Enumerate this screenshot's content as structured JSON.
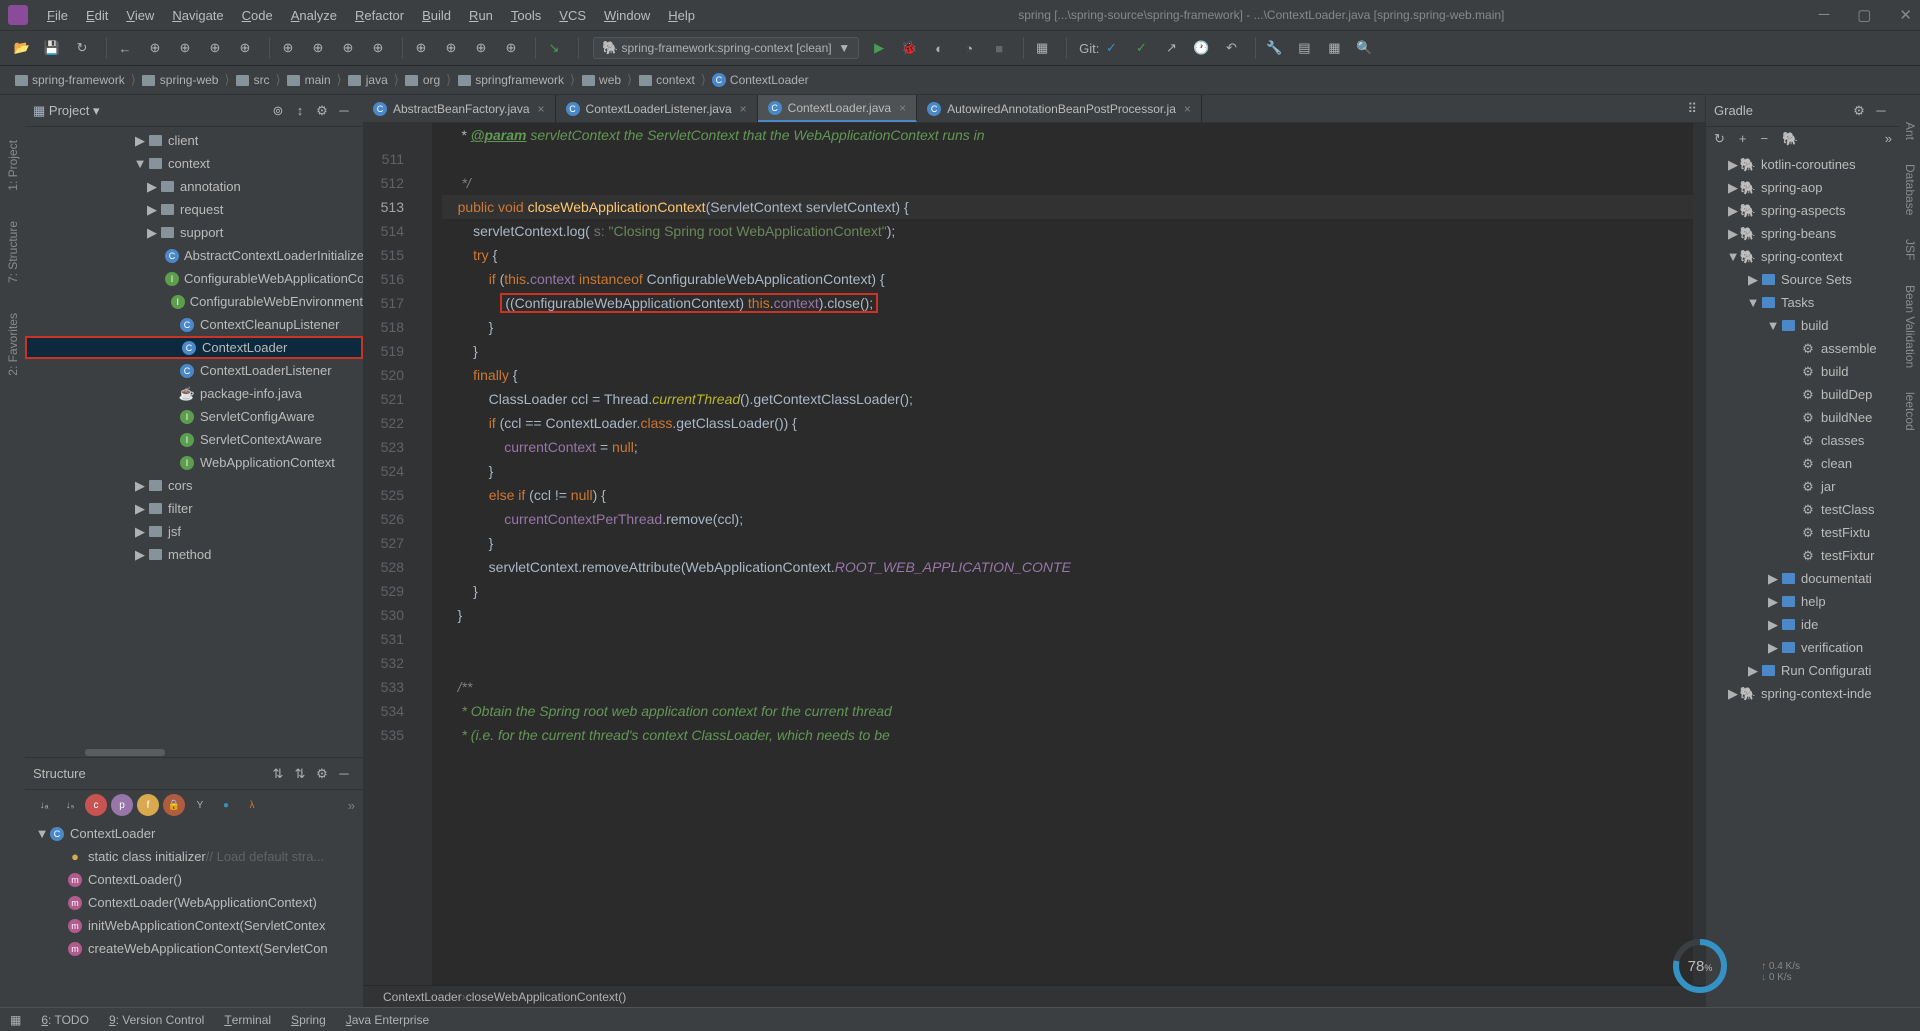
{
  "titlebar": {
    "title": "spring [...\\spring-source\\spring-framework] - ...\\ContextLoader.java [spring.spring-web.main]"
  },
  "menu": [
    "File",
    "Edit",
    "View",
    "Navigate",
    "Code",
    "Analyze",
    "Refactor",
    "Build",
    "Run",
    "Tools",
    "VCS",
    "Window",
    "Help"
  ],
  "runconfig": "spring-framework:spring-context [clean]",
  "git_label": "Git:",
  "breadcrumbs": [
    {
      "icon": "folder",
      "label": "spring-framework"
    },
    {
      "icon": "folder",
      "label": "spring-web"
    },
    {
      "icon": "folder",
      "label": "src"
    },
    {
      "icon": "folder",
      "label": "main"
    },
    {
      "icon": "folder",
      "label": "java"
    },
    {
      "icon": "folder",
      "label": "org"
    },
    {
      "icon": "folder",
      "label": "springframework"
    },
    {
      "icon": "folder",
      "label": "web"
    },
    {
      "icon": "folder",
      "label": "context"
    },
    {
      "icon": "class",
      "label": "ContextLoader"
    }
  ],
  "projectPane": {
    "title": "Project",
    "nodes": [
      {
        "indent": "ind-m",
        "arrow": "▶",
        "icon": "folder",
        "label": "client"
      },
      {
        "indent": "ind-m",
        "arrow": "▼",
        "icon": "folder",
        "label": "context"
      },
      {
        "indent": "ind-1",
        "arrow": "▶",
        "icon": "folder",
        "label": "annotation"
      },
      {
        "indent": "ind-1",
        "arrow": "▶",
        "icon": "folder",
        "label": "request"
      },
      {
        "indent": "ind-1",
        "arrow": "▶",
        "icon": "folder",
        "label": "support"
      },
      {
        "indent": "ind-2",
        "arrow": "",
        "icon": "class",
        "label": "AbstractContextLoaderInitializer"
      },
      {
        "indent": "ind-2",
        "arrow": "",
        "icon": "iface",
        "label": "ConfigurableWebApplicationCo"
      },
      {
        "indent": "ind-2",
        "arrow": "",
        "icon": "iface",
        "label": "ConfigurableWebEnvironment"
      },
      {
        "indent": "ind-2",
        "arrow": "",
        "icon": "class",
        "label": "ContextCleanupListener"
      },
      {
        "indent": "ind-2",
        "arrow": "",
        "icon": "class",
        "label": "ContextLoader",
        "selected": true
      },
      {
        "indent": "ind-2",
        "arrow": "",
        "icon": "class",
        "label": "ContextLoaderListener"
      },
      {
        "indent": "ind-2",
        "arrow": "",
        "icon": "java",
        "label": "package-info.java"
      },
      {
        "indent": "ind-2",
        "arrow": "",
        "icon": "iface",
        "label": "ServletConfigAware"
      },
      {
        "indent": "ind-2",
        "arrow": "",
        "icon": "iface",
        "label": "ServletContextAware"
      },
      {
        "indent": "ind-2",
        "arrow": "",
        "icon": "iface",
        "label": "WebApplicationContext"
      },
      {
        "indent": "ind-m",
        "arrow": "▶",
        "icon": "folder",
        "label": "cors"
      },
      {
        "indent": "ind-m",
        "arrow": "▶",
        "icon": "folder",
        "label": "filter"
      },
      {
        "indent": "ind-m",
        "arrow": "▶",
        "icon": "folder",
        "label": "jsf"
      },
      {
        "indent": "ind-m",
        "arrow": "▶",
        "icon": "folder",
        "label": "method"
      }
    ]
  },
  "structurePane": {
    "title": "Structure",
    "nodes": [
      {
        "icon": "class",
        "label": "ContextLoader",
        "arrow": "▼"
      },
      {
        "icon": "orange",
        "label": "static class initializer",
        "comment": "// Load default stra..."
      },
      {
        "icon": "method",
        "label": "ContextLoader()"
      },
      {
        "icon": "method",
        "label": "ContextLoader(WebApplicationContext)"
      },
      {
        "icon": "method",
        "label": "initWebApplicationContext(ServletContex"
      },
      {
        "icon": "method",
        "label": "createWebApplicationContext(ServletCon"
      }
    ]
  },
  "tabs": [
    {
      "label": "AbstractBeanFactory.java",
      "active": false
    },
    {
      "label": "ContextLoaderListener.java",
      "active": false
    },
    {
      "label": "ContextLoader.java",
      "active": true
    },
    {
      "label": "AutowiredAnnotationBeanPostProcessor.ja",
      "active": false
    }
  ],
  "code": {
    "startLine": 511,
    "lines": [
      {
        "n": "",
        "html": "     * <span class='c-doctag'>@param</span> <span class='c-doc'>servletContext the ServletContext that the WebApplicationContext runs in</span>"
      },
      {
        "n": 511,
        "html": ""
      },
      {
        "n": 512,
        "html": "     <span class='c-com'>*/</span>"
      },
      {
        "n": 513,
        "html": "    <span class='c-kw'>public void</span> <span class='c-fn'>closeWebApplicationContext</span>(ServletContext servletContext) {",
        "current": true
      },
      {
        "n": 514,
        "html": "        servletContext.log( <span class='c-param'>s:</span> <span class='c-str'>\"Closing Spring root WebApplicationContext\"</span>);"
      },
      {
        "n": 515,
        "html": "        <span class='c-kw'>try</span> {"
      },
      {
        "n": 516,
        "html": "            <span class='c-kw'>if</span> (<span class='c-this'>this</span>.<span class='c-field'>context</span> <span class='c-kw'>instanceof</span> ConfigurableWebApplicationContext) {"
      },
      {
        "n": 517,
        "html": "               <span class='highlight-box'>((ConfigurableWebApplicationContext) <span class='c-this'>this</span>.<span class='c-field'>context</span>).close();</span>"
      },
      {
        "n": 518,
        "html": "            }"
      },
      {
        "n": 519,
        "html": "        }"
      },
      {
        "n": 520,
        "html": "        <span class='c-kw'>finally</span> {"
      },
      {
        "n": 521,
        "html": "            ClassLoader ccl = Thread.<span class='c-anno'>currentThread</span>().getContextClassLoader();"
      },
      {
        "n": 522,
        "html": "            <span class='c-kw'>if</span> (ccl == ContextLoader.<span class='c-kw'>class</span>.getClassLoader()) {"
      },
      {
        "n": 523,
        "html": "                <span class='c-field'>currentContext</span> = <span class='c-kw'>null</span>;"
      },
      {
        "n": 524,
        "html": "            }"
      },
      {
        "n": 525,
        "html": "            <span class='c-kw'>else if</span> (ccl != <span class='c-kw'>null</span>) {"
      },
      {
        "n": 526,
        "html": "                <span class='c-field'>currentContextPerThread</span>.remove(ccl);"
      },
      {
        "n": 527,
        "html": "            }"
      },
      {
        "n": 528,
        "html": "            servletContext.removeAttribute(WebApplicationContext.<span class='c-const'>ROOT_WEB_APPLICATION_CONTE</span>"
      },
      {
        "n": 529,
        "html": "        }"
      },
      {
        "n": 530,
        "html": "    }"
      },
      {
        "n": 531,
        "html": ""
      },
      {
        "n": 532,
        "html": ""
      },
      {
        "n": 533,
        "html": "    <span class='c-com'>/**</span>"
      },
      {
        "n": 534,
        "html": "     <span class='c-doc'>* Obtain the Spring root web application context for the current thread</span>"
      },
      {
        "n": 535,
        "html": "     <span class='c-doc'>* (i.e. for the current thread's context ClassLoader, which needs to be</span>"
      }
    ],
    "status_crumbs": [
      "ContextLoader",
      "closeWebApplicationContext()"
    ]
  },
  "gradle": {
    "title": "Gradle",
    "nodes": [
      {
        "indent": 20,
        "arrow": "▶",
        "icon": "el",
        "label": "kotlin-coroutines"
      },
      {
        "indent": 20,
        "arrow": "▶",
        "icon": "el",
        "label": "spring-aop"
      },
      {
        "indent": 20,
        "arrow": "▶",
        "icon": "el",
        "label": "spring-aspects"
      },
      {
        "indent": 20,
        "arrow": "▶",
        "icon": "el",
        "label": "spring-beans"
      },
      {
        "indent": 20,
        "arrow": "▼",
        "icon": "el",
        "label": "spring-context"
      },
      {
        "indent": 40,
        "arrow": "▶",
        "icon": "fld",
        "label": "Source Sets"
      },
      {
        "indent": 40,
        "arrow": "▼",
        "icon": "fld",
        "label": "Tasks"
      },
      {
        "indent": 60,
        "arrow": "▼",
        "icon": "fld",
        "label": "build"
      },
      {
        "indent": 80,
        "arrow": "",
        "icon": "gear",
        "label": "assemble"
      },
      {
        "indent": 80,
        "arrow": "",
        "icon": "gear",
        "label": "build"
      },
      {
        "indent": 80,
        "arrow": "",
        "icon": "gear",
        "label": "buildDep"
      },
      {
        "indent": 80,
        "arrow": "",
        "icon": "gear",
        "label": "buildNee"
      },
      {
        "indent": 80,
        "arrow": "",
        "icon": "gear",
        "label": "classes"
      },
      {
        "indent": 80,
        "arrow": "",
        "icon": "gear",
        "label": "clean"
      },
      {
        "indent": 80,
        "arrow": "",
        "icon": "gear",
        "label": "jar"
      },
      {
        "indent": 80,
        "arrow": "",
        "icon": "gear",
        "label": "testClass"
      },
      {
        "indent": 80,
        "arrow": "",
        "icon": "gear",
        "label": "testFixtu"
      },
      {
        "indent": 80,
        "arrow": "",
        "icon": "gear",
        "label": "testFixtur"
      },
      {
        "indent": 60,
        "arrow": "▶",
        "icon": "fld",
        "label": "documentati"
      },
      {
        "indent": 60,
        "arrow": "▶",
        "icon": "fld",
        "label": "help"
      },
      {
        "indent": 60,
        "arrow": "▶",
        "icon": "fld",
        "label": "ide"
      },
      {
        "indent": 60,
        "arrow": "▶",
        "icon": "fld",
        "label": "verification"
      },
      {
        "indent": 40,
        "arrow": "▶",
        "icon": "fld",
        "label": "Run Configurati"
      },
      {
        "indent": 20,
        "arrow": "▶",
        "icon": "el",
        "label": "spring-context-inde"
      }
    ]
  },
  "leftGutter": [
    "1: Project",
    "7: Structure",
    "2: Favorites"
  ],
  "rightGutter": [
    "Ant",
    "Database",
    "JSF",
    "Bean Validation",
    "leetcod"
  ],
  "statusbar": {
    "items": [
      "6: TODO",
      "9: Version Control",
      "Terminal",
      "Spring",
      "Java Enterprise"
    ]
  },
  "perf": {
    "value": "78",
    "unit": "%",
    "up": "0.4",
    "down": "0",
    "kws": "K/s"
  }
}
